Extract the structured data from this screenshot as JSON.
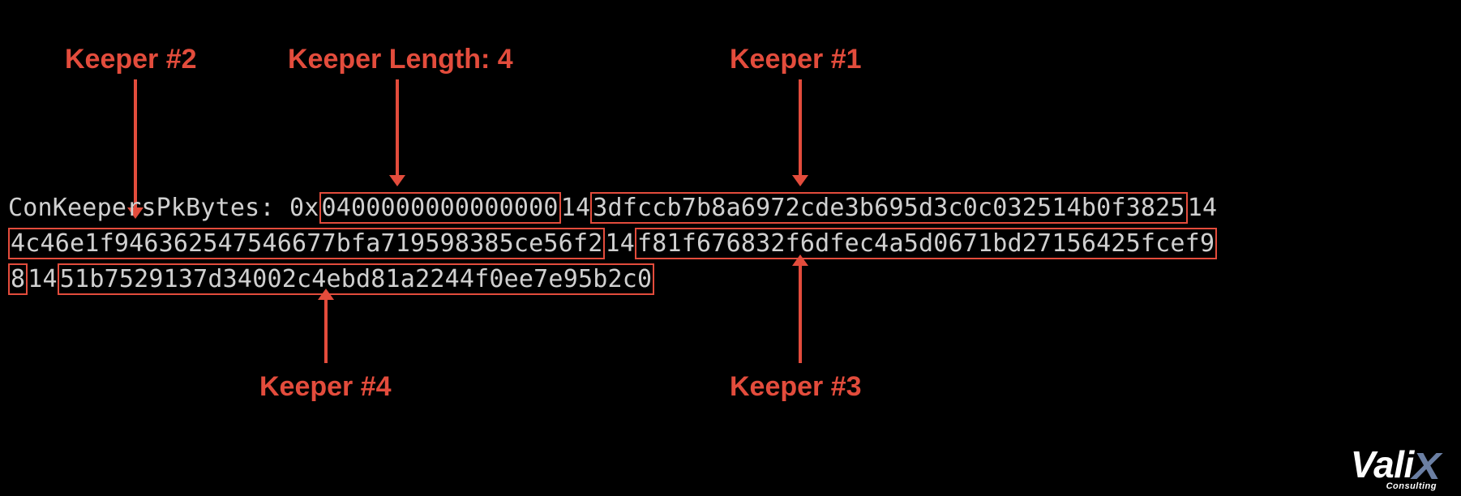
{
  "labels": {
    "keeper2": "Keeper #2",
    "keeperLength": "Keeper Length: 4",
    "keeper1": "Keeper #1",
    "keeper4": "Keeper #4",
    "keeper3": "Keeper #3"
  },
  "hex": {
    "prefix": "ConKeepersPkBytes: 0x",
    "len": "0400000000000000",
    "sep1": "14",
    "k1": "3dfccb7b8a6972cde3b695d3c0c032514b0f3825",
    "sep2": "14",
    "k2a": "4c46e1f946362547546677bfa719598385ce56f2",
    "sep3": "14",
    "k3a": "f81f676832f6dfec4a5d0671bd27156425fcef9",
    "k3b": "8",
    "sep4": "14",
    "k4": "51b7529137d34002c4ebd81a2244f0ee7e95b2c0"
  },
  "logo": {
    "brand_pre": "Vali",
    "brand_x": "X",
    "sub": "Consulting"
  }
}
